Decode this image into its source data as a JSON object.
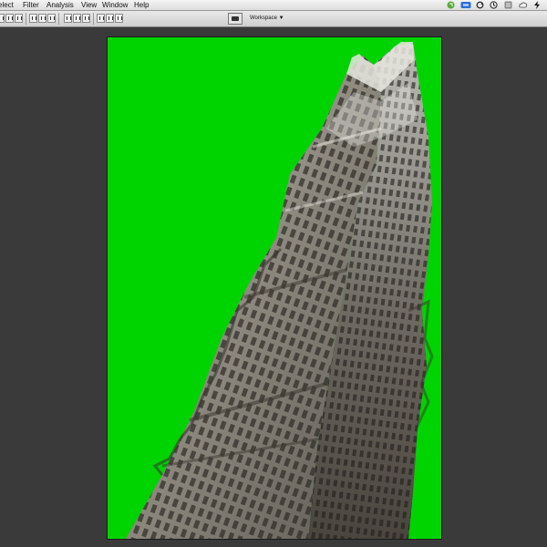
{
  "menubar": {
    "items": [
      "elect",
      "Filter",
      "Analysis",
      "View",
      "Window",
      "Help"
    ]
  },
  "optionsbar": {
    "workspace_label": "Workspace",
    "workspace_arrow": "▼"
  },
  "icons": {
    "status": [
      "evernote-icon",
      "adobe-icon",
      "sync-icon",
      "time-machine-icon",
      "bluetooth-icon",
      "battery-icon",
      "cloud-icon",
      "power-icon"
    ],
    "workspace": "workspace-camera-icon"
  },
  "colors": {
    "background": "#3a3a3a",
    "green_screen": "#00d400"
  }
}
